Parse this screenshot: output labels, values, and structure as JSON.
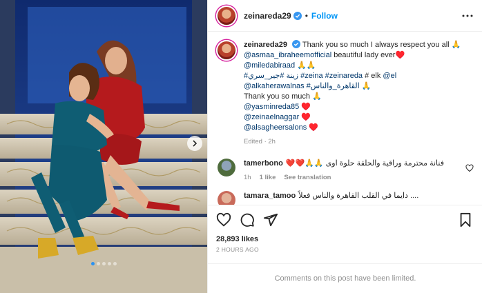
{
  "header": {
    "username": "zeinareda29",
    "separator": "•",
    "follow_label": "Follow"
  },
  "caption": {
    "username": "zeinareda29",
    "line1": "Thank you so much I always respect you all 🙏",
    "mention1": "@asmaa_ibraheemofficial",
    "line2_rest": " beautiful lady ever♥️",
    "mention2": "@miledabiraad",
    "line3_rest": " 🙏🙏",
    "hashtags": "#زينة #جير_سري #zeina #zeinareda",
    "line4_mid": " # elk ",
    "mention_el": "@el",
    "mention3": "@alkaherawalnas",
    "hashtag_ar": " #القاهرة_والناس",
    "line5_rest": " 🙏",
    "line6": "Thank you so much 🙏",
    "mention4": "@yasminreda85",
    "heart": " ♥️",
    "mention5": "@zeinaelnaggar",
    "mention6": "@alsagheersalons",
    "edited": "Edited · 2h"
  },
  "comments": [
    {
      "username": "tamerbono",
      "text": "❤️❤️🙏🙏 فنانة محترمة وراقية والحلقة حلوة اوى",
      "time": "1h",
      "likes": "1 like",
      "translate": "See translation"
    },
    {
      "username": "tamara_tamoo",
      "text": "دايما في القلب القاهرة والناس فعلاً ...."
    }
  ],
  "post": {
    "likes": "28,893 likes",
    "time": "2 HOURS AGO",
    "limited": "Comments on this post have been limited."
  },
  "carousel": {
    "count": 5,
    "active": 0
  },
  "colors": {
    "accent": "#0095f6",
    "link": "#00376b",
    "muted": "#8e8e8e",
    "verified": "#3897f0"
  }
}
